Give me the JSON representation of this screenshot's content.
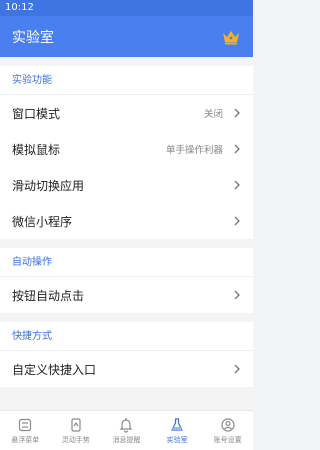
{
  "status_bar": {
    "time": "10:12"
  },
  "app_bar": {
    "title": "实验室",
    "icon": "crown-icon"
  },
  "sections": [
    {
      "header": "实验功能",
      "items": [
        {
          "label": "窗口模式",
          "value": "关闭"
        },
        {
          "label": "模拟鼠标",
          "value": "单手操作利器"
        },
        {
          "label": "滑动切换应用",
          "value": ""
        },
        {
          "label": "微信小程序",
          "value": ""
        }
      ]
    },
    {
      "header": "自动操作",
      "items": [
        {
          "label": "按钮自动点击",
          "value": ""
        }
      ]
    },
    {
      "header": "快捷方式",
      "items": [
        {
          "label": "自定义快捷入口",
          "value": ""
        }
      ]
    }
  ],
  "tabs": [
    {
      "label": "悬浮菜单",
      "icon": "float-menu-icon",
      "active": false
    },
    {
      "label": "灵动手势",
      "icon": "gesture-icon",
      "active": false
    },
    {
      "label": "消息提醒",
      "icon": "bell-icon",
      "active": false
    },
    {
      "label": "实验室",
      "icon": "flask-icon",
      "active": true
    },
    {
      "label": "账号设置",
      "icon": "account-icon",
      "active": false
    }
  ],
  "colors": {
    "accent": "#4a7ff0",
    "section_text": "#3c6fd8",
    "crown": "#f6b21b"
  }
}
